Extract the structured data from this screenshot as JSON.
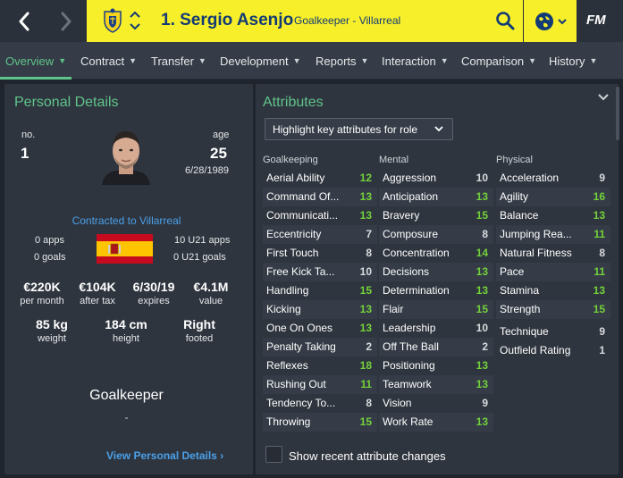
{
  "header": {
    "player_name": "1. Sergio Asenjo",
    "player_subtitle": "Goalkeeper - Villarreal",
    "logo": "FM",
    "colors": {
      "club_bar": "#f7ef2a",
      "club_text": "#123a75",
      "accent": "#5fc48a",
      "link": "#4aa0e8"
    },
    "icons": [
      "back-arrow-icon",
      "forward-arrow-icon",
      "club-crest-icon",
      "up-down-arrow-icon",
      "search-icon",
      "globe-icon",
      "chevron-down-icon"
    ]
  },
  "tabs": [
    {
      "label": "Overview"
    },
    {
      "label": "Contract"
    },
    {
      "label": "Transfer"
    },
    {
      "label": "Development"
    },
    {
      "label": "Reports"
    },
    {
      "label": "Interaction"
    },
    {
      "label": "Comparison"
    },
    {
      "label": "History"
    }
  ],
  "personal": {
    "title": "Personal Details",
    "no_label": "no.",
    "no_value": "1",
    "age_label": "age",
    "age_value": "25",
    "dob": "6/28/1989",
    "contract": "Contracted to Villarreal",
    "apps": "0 apps",
    "goals": "0 goals",
    "u21_apps": "10 U21 apps",
    "u21_goals": "0 U21 goals",
    "wage": "€220K",
    "wage_label": "per month",
    "after_tax": "€104K",
    "after_tax_label": "after tax",
    "expires": "6/30/19",
    "expires_label": "expires",
    "value": "€4.1M",
    "value_label": "value",
    "weight": "85 kg",
    "weight_label": "weight",
    "height": "184 cm",
    "height_label": "height",
    "foot": "Right",
    "foot_label": "footed",
    "position": "Goalkeeper",
    "position_sub": "-",
    "view_link": "View Personal Details"
  },
  "attributes": {
    "title": "Attributes",
    "highlight": "Highlight key attributes for role",
    "show_changes": "Show recent attribute changes",
    "columns": [
      {
        "heading": "Goalkeeping",
        "items": [
          {
            "name": "Aerial Ability",
            "value": "12"
          },
          {
            "name": "Command Of...",
            "value": "13"
          },
          {
            "name": "Communicati...",
            "value": "13"
          },
          {
            "name": "Eccentricity",
            "value": "7"
          },
          {
            "name": "First Touch",
            "value": "8"
          },
          {
            "name": "Free Kick Ta...",
            "value": "10"
          },
          {
            "name": "Handling",
            "value": "15"
          },
          {
            "name": "Kicking",
            "value": "13"
          },
          {
            "name": "One On Ones",
            "value": "13"
          },
          {
            "name": "Penalty Taking",
            "value": "2"
          },
          {
            "name": "Reflexes",
            "value": "18"
          },
          {
            "name": "Rushing Out",
            "value": "11"
          },
          {
            "name": "Tendency To...",
            "value": "8"
          },
          {
            "name": "Throwing",
            "value": "15"
          }
        ]
      },
      {
        "heading": "Mental",
        "items": [
          {
            "name": "Aggression",
            "value": "10"
          },
          {
            "name": "Anticipation",
            "value": "13"
          },
          {
            "name": "Bravery",
            "value": "15"
          },
          {
            "name": "Composure",
            "value": "8"
          },
          {
            "name": "Concentration",
            "value": "14"
          },
          {
            "name": "Decisions",
            "value": "13"
          },
          {
            "name": "Determination",
            "value": "13"
          },
          {
            "name": "Flair",
            "value": "15"
          },
          {
            "name": "Leadership",
            "value": "10"
          },
          {
            "name": "Off The Ball",
            "value": "2"
          },
          {
            "name": "Positioning",
            "value": "13"
          },
          {
            "name": "Teamwork",
            "value": "13"
          },
          {
            "name": "Vision",
            "value": "9"
          },
          {
            "name": "Work Rate",
            "value": "13"
          }
        ]
      },
      {
        "heading": "Physical",
        "items": [
          {
            "name": "Acceleration",
            "value": "9"
          },
          {
            "name": "Agility",
            "value": "16"
          },
          {
            "name": "Balance",
            "value": "13"
          },
          {
            "name": "Jumping Rea...",
            "value": "11"
          },
          {
            "name": "Natural Fitness",
            "value": "8"
          },
          {
            "name": "Pace",
            "value": "11"
          },
          {
            "name": "Stamina",
            "value": "13"
          },
          {
            "name": "Strength",
            "value": "15"
          }
        ]
      }
    ],
    "extra": [
      {
        "name": "Technique",
        "value": "9"
      },
      {
        "name": "Outfield Rating",
        "value": "1"
      }
    ]
  }
}
